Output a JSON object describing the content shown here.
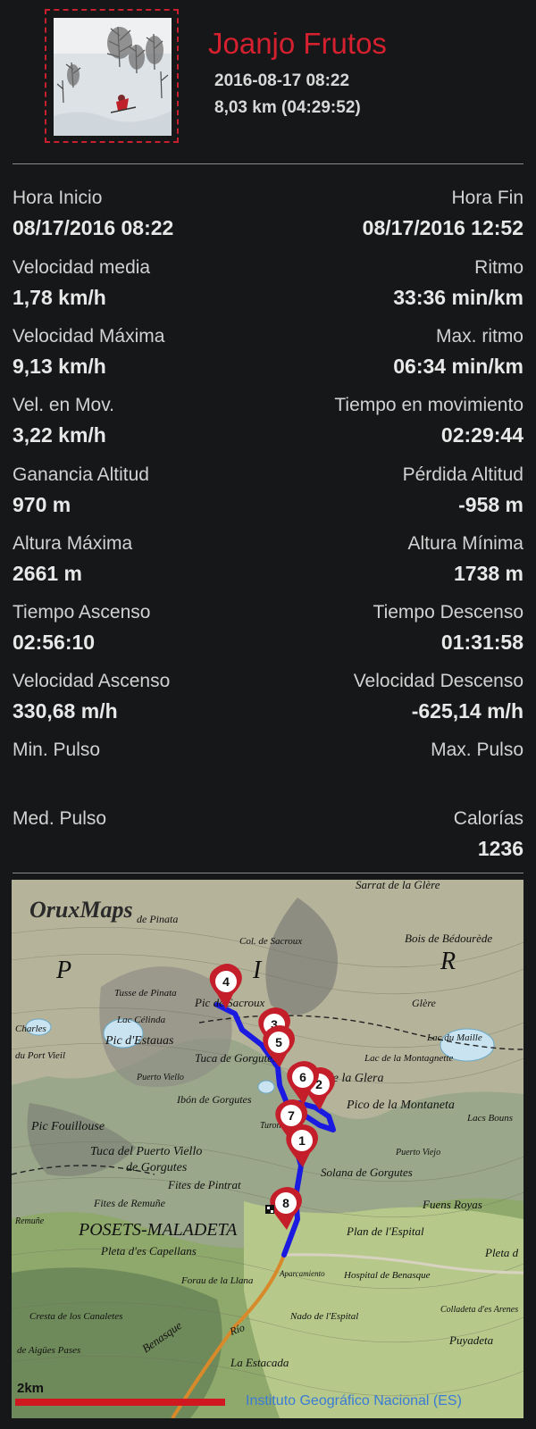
{
  "header": {
    "name": "Joanjo Frutos",
    "datetime": "2016-08-17 08:22",
    "summary": "8,03 km (04:29:52)"
  },
  "stats": [
    {
      "left_label": "Hora Inicio",
      "left_value": "08/17/2016 08:22",
      "right_label": "Hora Fin",
      "right_value": "08/17/2016 12:52"
    },
    {
      "left_label": "Velocidad media",
      "left_value": "1,78 km/h",
      "right_label": "Ritmo",
      "right_value": "33:36 min/km"
    },
    {
      "left_label": "Velocidad Máxima",
      "left_value": "9,13 km/h",
      "right_label": "Max. ritmo",
      "right_value": "06:34 min/km"
    },
    {
      "left_label": "Vel. en Mov.",
      "left_value": "3,22 km/h",
      "right_label": "Tiempo en movimiento",
      "right_value": "02:29:44"
    },
    {
      "left_label": "Ganancia Altitud",
      "left_value": "970 m",
      "right_label": "Pérdida Altitud",
      "right_value": "-958 m"
    },
    {
      "left_label": "Altura Máxima",
      "left_value": "2661 m",
      "right_label": "Altura Mínima",
      "right_value": "1738 m"
    },
    {
      "left_label": "Tiempo Ascenso",
      "left_value": "02:56:10",
      "right_label": "Tiempo Descenso",
      "right_value": "01:31:58"
    },
    {
      "left_label": "Velocidad Ascenso",
      "left_value": "330,68 m/h",
      "right_label": "Velocidad Descenso",
      "right_value": "-625,14 m/h"
    },
    {
      "left_label": "Min. Pulso",
      "left_value": "",
      "right_label": "Max. Pulso",
      "right_value": ""
    },
    {
      "left_label": "Med. Pulso",
      "left_value": "",
      "right_label": "Calorías",
      "right_value": "1236"
    }
  ],
  "map": {
    "brand": "OruxMaps",
    "scale_label": "2km",
    "attribution": "Instituto Geográfico Nacional (ES)",
    "waypoints": [
      "1",
      "2",
      "3",
      "4",
      "5",
      "6",
      "7",
      "8"
    ],
    "labels": {
      "sarrat": "Sarrat de la Glère",
      "pinata": "de Pinata",
      "col_sacroux": "Col. de Sacroux",
      "bedourede": "Bois de Bédourède",
      "letter_p": "P",
      "letter_i": "I",
      "letter_r": "R",
      "tusse": "Tusse de Pinata",
      "celinda": "Lac Célinda",
      "pic_sacroux": "Pic de Sacroux",
      "glere_small": "Glère",
      "charles": "Charles",
      "maille": "Lac du Maille",
      "pic_estauas": "Pic d'Estauas",
      "tuca_gorgutes": "Tuca de Gorgutes",
      "lac_montagnette": "Lac de la Montagnette",
      "port_vieil": "du Port Vieil",
      "tuca_glera": "Tuca de la Glera",
      "puerto_viello": "Puerto Viello",
      "ibon_gorgutes": "Ibón de Gorgutes",
      "pico_montaneta": "Pico de la Montaneta",
      "lacs_bouns": "Lacs Bouns",
      "pic_fouillouse": "Pic Fouillouse",
      "turonet": "Turonet",
      "tuca_puerto": "Tuca del Puerto Viello",
      "puerto_viejo": "Puerto Viejo",
      "de_gorgutes": "de Gorgutes",
      "solana": "Solana de Gorgutes",
      "fites_pintrat": "Fites de Pintrat",
      "fites_remune": "Fites de Remuñe",
      "fuens_royas": "Fuens Royas",
      "posets": "POSETS-MALADETA",
      "plan_espital": "Plan de l'Espital",
      "pleta_capellans": "Pleta d'es Capellans",
      "pleta": "Pleta d",
      "aparcamiento": "Aparcamiento",
      "forau_llana": "Forau de la Llana",
      "hospital": "Hospital de Benasque",
      "cresta": "Cresta de los Canaletes",
      "nado": "Nado de l'Espital",
      "colladeta": "Colladeta d'es Arenes",
      "benasque": "Benasque",
      "rio": "Río",
      "aigues": "de Aigües Pases",
      "estacada": "La Estacada",
      "puyadeta": "Puyadeta",
      "remune": "Remuñe"
    },
    "colors": {
      "route": "#1a1ae0",
      "marker": "#c41e2a",
      "scale_bar": "#d01820",
      "attribution": "#3a7bd5"
    }
  }
}
